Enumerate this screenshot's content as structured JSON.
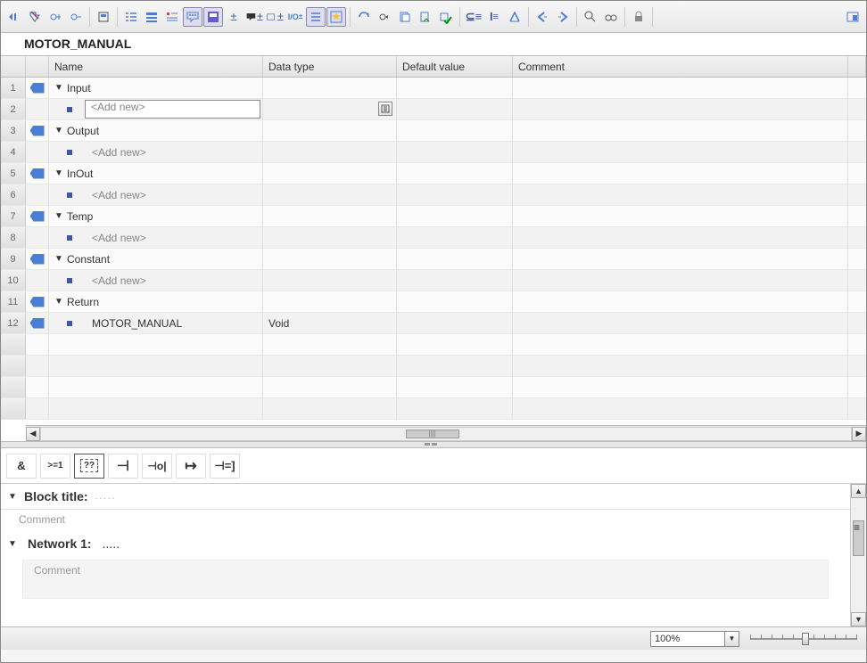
{
  "title": "MOTOR_MANUAL",
  "columns": {
    "name": "Name",
    "datatype": "Data type",
    "default": "Default value",
    "comment": "Comment"
  },
  "sections": {
    "input": "Input",
    "output": "Output",
    "inout": "InOut",
    "temp": "Temp",
    "constant": "Constant",
    "return": "Return"
  },
  "placeholders": {
    "add_new": "<Add new>"
  },
  "rows": {
    "return_item": {
      "name": "MOTOR_MANUAL",
      "type": "Void"
    }
  },
  "rownums": [
    "1",
    "2",
    "3",
    "4",
    "5",
    "6",
    "7",
    "8",
    "9",
    "10",
    "11",
    "12"
  ],
  "favbar": {
    "and": "&",
    "gte1": ">=1",
    "qq": "??",
    "assign": "⊣",
    "negassign": "⊣o|",
    "jump": "↦",
    "branch": "⊣=]"
  },
  "editor": {
    "block_title_label": "Block title:",
    "block_title_dots": ".....",
    "comment": "Comment",
    "network_label": "Network 1:",
    "network_dots": ".....",
    "network_comment": "Comment"
  },
  "status": {
    "zoom": "100%"
  }
}
